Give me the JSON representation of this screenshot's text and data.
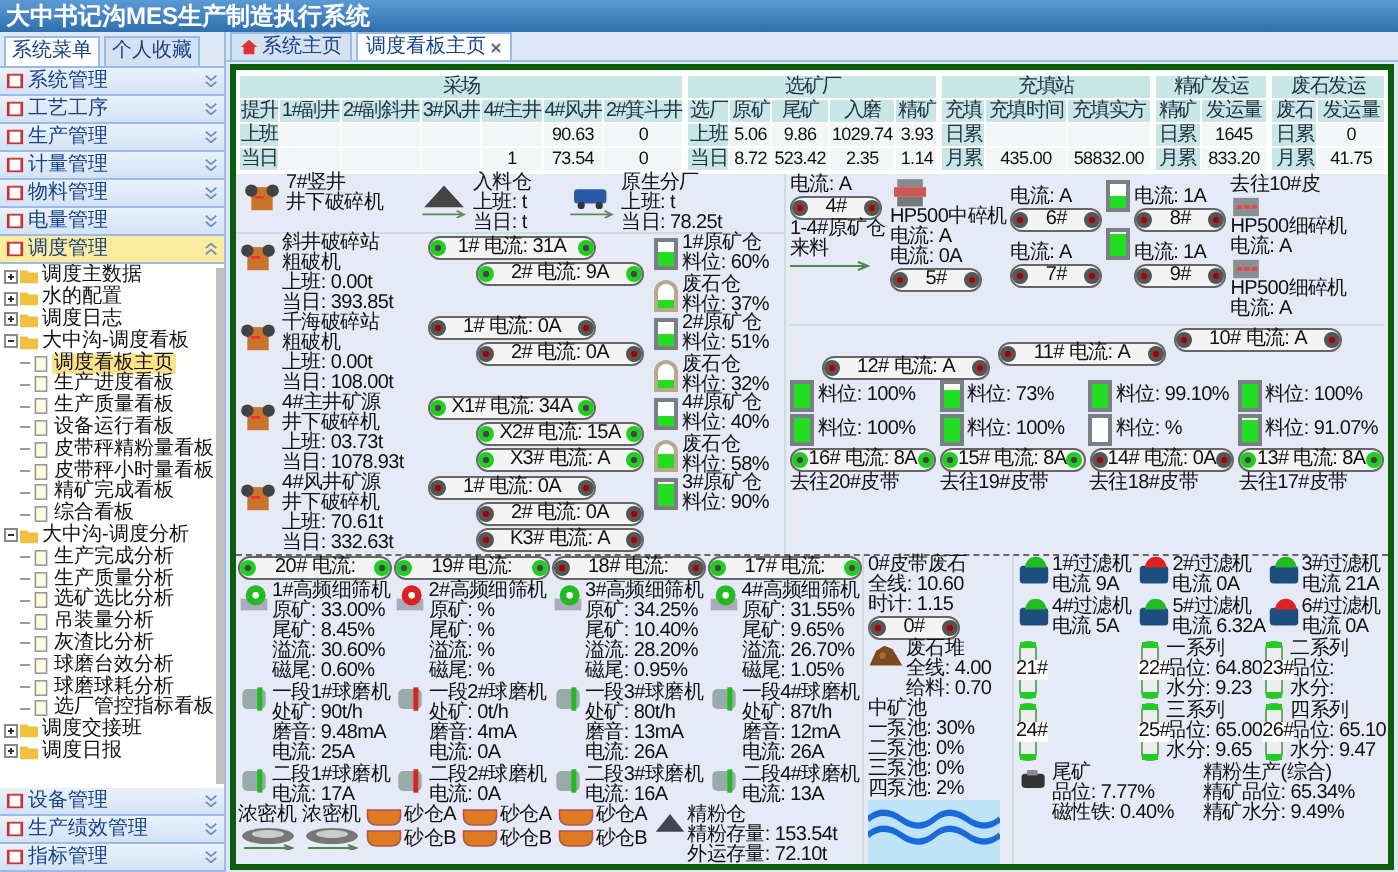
{
  "header": {
    "title": "大中书记沟MES生产制造执行系统"
  },
  "sidebar": {
    "tabs": [
      {
        "label": "系统菜单",
        "selected": true
      },
      {
        "label": "个人收藏",
        "selected": false
      }
    ],
    "menu": [
      {
        "label": "系统管理",
        "expanded": false
      },
      {
        "label": "工艺工序",
        "expanded": false
      },
      {
        "label": "生产管理",
        "expanded": false
      },
      {
        "label": "计量管理",
        "expanded": false
      },
      {
        "label": "物料管理",
        "expanded": false
      },
      {
        "label": "电量管理",
        "expanded": false
      },
      {
        "label": "调度管理",
        "expanded": true
      }
    ],
    "tree": [
      {
        "kind": "folder",
        "label": "调度主数据",
        "expanded": false
      },
      {
        "kind": "folder",
        "label": "水的配置",
        "expanded": false
      },
      {
        "kind": "folder",
        "label": "调度日志",
        "expanded": false
      },
      {
        "kind": "folder",
        "label": "大中沟-调度看板",
        "expanded": true,
        "children": [
          {
            "kind": "page",
            "label": "调度看板主页",
            "selected": true
          },
          {
            "kind": "page",
            "label": "生产进度看板",
            "selected": false
          },
          {
            "kind": "page",
            "label": "生产质量看板",
            "selected": false
          },
          {
            "kind": "page",
            "label": "设备运行看板",
            "selected": false
          },
          {
            "kind": "page",
            "label": "皮带秤精粉量看板",
            "selected": false
          },
          {
            "kind": "page",
            "label": "皮带秤小时量看板",
            "selected": false
          },
          {
            "kind": "page",
            "label": "精矿完成看板",
            "selected": false
          },
          {
            "kind": "page",
            "label": "综合看板",
            "selected": false
          }
        ]
      },
      {
        "kind": "folder",
        "label": "大中沟-调度分析",
        "expanded": true,
        "children": [
          {
            "kind": "page",
            "label": "生产完成分析",
            "selected": false
          },
          {
            "kind": "page",
            "label": "生产质量分析",
            "selected": false
          },
          {
            "kind": "page",
            "label": "选矿选比分析",
            "selected": false
          },
          {
            "kind": "page",
            "label": "吊装量分析",
            "selected": false
          },
          {
            "kind": "page",
            "label": "灰渣比分析",
            "selected": false
          },
          {
            "kind": "page",
            "label": "球磨台效分析",
            "selected": false
          },
          {
            "kind": "page",
            "label": "球磨球耗分析",
            "selected": false
          },
          {
            "kind": "page",
            "label": "选厂管控指标看板",
            "selected": false
          }
        ]
      },
      {
        "kind": "folder",
        "label": "调度交接班",
        "expanded": false
      },
      {
        "kind": "folder",
        "label": "调度日报",
        "expanded": false
      }
    ],
    "menu_bottom": [
      {
        "label": "设备管理",
        "expanded": false
      },
      {
        "label": "生产绩效管理",
        "expanded": false
      },
      {
        "label": "指标管理",
        "expanded": false
      }
    ]
  },
  "tabs": [
    {
      "label": "系统主页",
      "selected": false,
      "closable": false
    },
    {
      "label": "调度看板主页",
      "selected": true,
      "closable": true
    }
  ],
  "tables": [
    {
      "title": "采场",
      "corner": "提升",
      "columns": [
        "1#副井",
        "2#副斜井",
        "3#风井",
        "4#主井",
        "4#风井",
        "2#箕斗井"
      ],
      "rows": [
        {
          "label": "上班",
          "cells": [
            "",
            "",
            "",
            "",
            "90.63",
            "0"
          ]
        },
        {
          "label": "当日",
          "cells": [
            "",
            "",
            "",
            "1",
            "73.54",
            "0"
          ]
        }
      ]
    },
    {
      "title": "选矿厂",
      "corner": "选厂",
      "columns": [
        "原矿",
        "尾矿",
        "入磨",
        "精矿"
      ],
      "rows": [
        {
          "label": "上班",
          "cells": [
            "5.06",
            "9.86",
            "1029.74",
            "3.93"
          ]
        },
        {
          "label": "当日",
          "cells": [
            "8.72",
            "523.42",
            "2.35",
            "1.14"
          ]
        }
      ]
    },
    {
      "title": "充填站",
      "corner": "充填",
      "columns": [
        "充填时间",
        "充填实方"
      ],
      "rows": [
        {
          "label": "日累",
          "cells": [
            "",
            ""
          ]
        },
        {
          "label": "月累",
          "cells": [
            "435.00",
            "58832.00"
          ]
        }
      ]
    },
    {
      "title": "精矿发运",
      "corner": "精矿",
      "columns": [
        "发运量"
      ],
      "rows": [
        {
          "label": "日累",
          "cells": [
            "1645"
          ]
        },
        {
          "label": "月累",
          "cells": [
            "833.20"
          ]
        }
      ]
    },
    {
      "title": "废石发运",
      "corner": "废石",
      "columns": [
        "发运量"
      ],
      "rows": [
        {
          "label": "日累",
          "cells": [
            "0"
          ]
        },
        {
          "label": "月累",
          "cells": [
            "41.75"
          ]
        }
      ]
    }
  ],
  "mine": [
    {
      "kind": "crusher",
      "lines": [
        "7#竖井",
        "井下破碎机"
      ]
    },
    {
      "kind": "pile",
      "lines": [
        "入料仓",
        "上班: t",
        "当日: t"
      ]
    },
    {
      "kind": "cart",
      "lines": [
        "原生分厂",
        "上班: t",
        "当日: 78.25t"
      ]
    }
  ],
  "lines": [
    {
      "crusher": [
        "斜井破碎站",
        "粗破机",
        "上班: 0.00t",
        "当日: 393.85t"
      ],
      "belts": [
        {
          "label": "1# 电流: 31A",
          "running": true
        },
        {
          "label": "2# 电流: 9A",
          "running": true
        }
      ],
      "bins": [
        {
          "kind": "ore",
          "name": "1#原矿仓",
          "reading": "料位: 60%",
          "level": 0.6
        },
        {
          "kind": "waste",
          "name": "废石仓",
          "reading": "料位: 37%",
          "level": 0.37
        }
      ]
    },
    {
      "crusher": [
        "千海破碎站",
        "粗破机",
        "上班: 0.00t",
        "当日: 108.00t"
      ],
      "belts": [
        {
          "label": "1# 电流: 0A",
          "running": false
        },
        {
          "label": "2# 电流: 0A",
          "running": false
        }
      ],
      "bins": [
        {
          "kind": "ore",
          "name": "2#原矿仓",
          "reading": "料位: 51%",
          "level": 0.51
        },
        {
          "kind": "waste",
          "name": "废石仓",
          "reading": "料位: 32%",
          "level": 0.32
        }
      ]
    },
    {
      "crusher": [
        "4#主井矿源",
        "井下破碎机",
        "上班: 03.73t",
        "当日: 1078.93t"
      ],
      "belts": [
        {
          "label": "X1# 电流: 34A",
          "running": true
        },
        {
          "label": "X2# 电流: 15A",
          "running": true
        },
        {
          "label": "X3# 电流: A",
          "running": true
        }
      ],
      "bins": [
        {
          "kind": "ore",
          "name": "4#原矿仓",
          "reading": "料位: 40%",
          "level": 0.4
        },
        {
          "kind": "waste",
          "name": "废石仓",
          "reading": "料位: 58%",
          "level": 0.58
        }
      ]
    },
    {
      "crusher": [
        "4#风井矿源",
        "井下破碎机",
        "上班: 70.61t",
        "当日: 332.63t"
      ],
      "belts": [
        {
          "label": "1# 电流: 0A",
          "running": false
        },
        {
          "label": "2# 电流: 0A",
          "running": false
        },
        {
          "label": "K3# 电流: A",
          "running": false
        }
      ],
      "bins": [
        {
          "kind": "ore",
          "name": "3#原矿仓",
          "reading": "料位: 90%",
          "level": 0.9
        }
      ]
    }
  ],
  "fine_crushing": {
    "feed": "1-4#原矿仓来料",
    "belts": [
      {
        "label": "4#",
        "caption": "电流: A",
        "running": false
      },
      {
        "label": "5#",
        "caption": "电流: 0A",
        "running": false
      },
      {
        "label": "6#",
        "caption": "电流: A",
        "running": false
      },
      {
        "label": "7#",
        "caption": "电流: A",
        "running": false
      },
      {
        "label": "8#",
        "caption": "电流: 1A",
        "running": false
      },
      {
        "label": "9#",
        "caption": "电流: 1A",
        "running": false
      }
    ],
    "mid_crusher": {
      "name": "HP500中碎机",
      "reading": "电流: A"
    },
    "bins": [
      {
        "level": 0.5
      },
      {
        "level": 0.9
      }
    ],
    "destination": "去往10#皮",
    "fine_crushers": [
      {
        "name": "HP500细碎机",
        "reading": "电流: A"
      },
      {
        "name": "HP500细碎机",
        "reading": "电流: A"
      }
    ]
  },
  "screening": {
    "top_belts": [
      {
        "label": "12# 电流: A",
        "running": false
      },
      {
        "label": "11# 电流: A",
        "running": false
      },
      {
        "label": "10# 电流: A",
        "running": false
      }
    ],
    "bins": [
      {
        "reading": "料位: 100%",
        "level": 1
      },
      {
        "reading": "料位: 73%",
        "level": 0.73
      },
      {
        "reading": "料位: 99.10%",
        "level": 0.99
      },
      {
        "reading": "料位: 100%",
        "level": 1
      },
      {
        "reading": "料位: 100%",
        "level": 1
      },
      {
        "reading": "料位: 100%",
        "level": 1
      },
      {
        "reading": "料位: %",
        "level": 0
      },
      {
        "reading": "料位: 91.07%",
        "level": 0.91
      }
    ],
    "bottom_belts": [
      {
        "label": "16# 电流: 8A",
        "running": true,
        "caption": "去往20#皮带"
      },
      {
        "label": "15# 电流: 8A",
        "running": true,
        "caption": "去往19#皮带"
      },
      {
        "label": "14# 电流: 0A",
        "running": false,
        "caption": "去往18#皮带"
      },
      {
        "label": "13# 电流: 8A",
        "running": true,
        "caption": "去往17#皮带"
      }
    ]
  },
  "grinding": [
    {
      "belt": {
        "label": "20# 电流:",
        "running": true
      },
      "screen": {
        "name": "1#高频细筛机",
        "running": true,
        "readings": [
          "原矿: 33.00%",
          "尾矿: 8.45%",
          "溢流: 30.60%",
          "磁尾: 0.60%"
        ]
      },
      "mill1": {
        "name": "一段1#球磨机",
        "running": true,
        "readings": [
          "处矿: 90t/h",
          "磨音: 9.48mA",
          "电流: 25A"
        ]
      },
      "mill2": {
        "name": "二段1#球磨机",
        "running": true,
        "readings": [
          "电流: 17A"
        ]
      }
    },
    {
      "belt": {
        "label": "19# 电流:",
        "running": true
      },
      "screen": {
        "name": "2#高频细筛机",
        "running": false,
        "readings": [
          "原矿: %",
          "尾矿: %",
          "溢流: %",
          "磁尾: %"
        ]
      },
      "mill1": {
        "name": "一段2#球磨机",
        "running": false,
        "readings": [
          "处矿: 0t/h",
          "磨音: 4mA",
          "电流: 0A"
        ]
      },
      "mill2": {
        "name": "二段2#球磨机",
        "running": false,
        "readings": [
          "电流: 0A"
        ]
      }
    },
    {
      "belt": {
        "label": "18# 电流:",
        "running": false
      },
      "screen": {
        "name": "3#高频细筛机",
        "running": true,
        "readings": [
          "原矿: 34.25%",
          "尾矿: 10.40%",
          "溢流: 28.20%",
          "磁尾: 0.95%"
        ]
      },
      "mill1": {
        "name": "一段3#球磨机",
        "running": true,
        "readings": [
          "处矿: 80t/h",
          "磨音: 13mA",
          "电流: 26A"
        ]
      },
      "mill2": {
        "name": "二段3#球磨机",
        "running": true,
        "readings": [
          "电流: 16A"
        ]
      }
    },
    {
      "belt": {
        "label": "17# 电流:",
        "running": true
      },
      "screen": {
        "name": "4#高频细筛机",
        "running": true,
        "readings": [
          "原矿: 31.55%",
          "尾矿: 9.65%",
          "溢流: 26.70%",
          "磁尾: 1.05%"
        ]
      },
      "mill1": {
        "name": "一段4#球磨机",
        "running": true,
        "readings": [
          "处矿: 87t/h",
          "磨音: 12mA",
          "电流: 26A"
        ]
      },
      "mill2": {
        "name": "二段4#球磨机",
        "running": true,
        "readings": [
          "电流: 13A"
        ]
      }
    }
  ],
  "storage": {
    "thickeners": [
      "浓密机",
      "浓密机"
    ],
    "sand_bins": [
      {
        "upper": "砂仓A",
        "lower": "砂仓B"
      },
      {
        "upper": "砂仓A",
        "lower": "砂仓B"
      },
      {
        "upper": "砂仓A",
        "lower": "砂仓B"
      }
    ]
  },
  "tailings": {
    "title": "0#皮带废石",
    "readings": [
      "全线: 10.60",
      "时计: 1.15"
    ],
    "belt": {
      "label": "0#",
      "running": false
    },
    "pile": {
      "title": "废石堆",
      "readings": [
        "全线: 4.00",
        "给料: 0.70"
      ]
    },
    "pools": {
      "title": "中矿池",
      "readings": [
        "一泵池: 30%",
        "二泵池: 0%",
        "三泵池: 0%",
        "四泵池: 2%"
      ]
    }
  },
  "filtration": {
    "filters": [
      {
        "name": "1#过滤机",
        "reading": "电流 9A",
        "running": true
      },
      {
        "name": "2#过滤机",
        "reading": "电流 0A",
        "running": false
      },
      {
        "name": "3#过滤机",
        "reading": "电流 21A",
        "running": true
      },
      {
        "name": "4#过滤机",
        "reading": "电流 5A",
        "running": true
      },
      {
        "name": "5#过滤机",
        "reading": "电流 6.32A",
        "running": true
      },
      {
        "name": "6#过滤机",
        "reading": "电流 0A",
        "running": false
      }
    ],
    "tanks": [
      {
        "name": "21#"
      },
      {
        "name": "22#",
        "series": "一系列",
        "readings": [
          "品位: 64.80",
          "水分: 9.23"
        ]
      },
      {
        "name": "23#",
        "series": "二系列",
        "readings": [
          "品位:",
          "水分:"
        ]
      },
      {
        "name": "24#"
      },
      {
        "name": "25#",
        "series": "三系列",
        "readings": [
          "品位: 65.00",
          "水分: 9.65"
        ]
      },
      {
        "name": "26#",
        "series": "四系列",
        "readings": [
          "品位: 65.10",
          "水分: 9.47"
        ]
      }
    ],
    "summary": [
      {
        "kind": "tailings",
        "title": "尾矿",
        "readings": [
          "品位: 7.77%",
          "磁性铁: 0.40%"
        ]
      },
      {
        "kind": "product",
        "title": "精粉生产(综合)",
        "readings": [
          "精矿品位: 65.34%",
          "精矿水分: 9.49%"
        ]
      },
      {
        "kind": "stock",
        "title": "精粉仓",
        "readings": [
          "精粉存量: 153.54t",
          "外运存量: 72.10t"
        ]
      }
    ]
  }
}
